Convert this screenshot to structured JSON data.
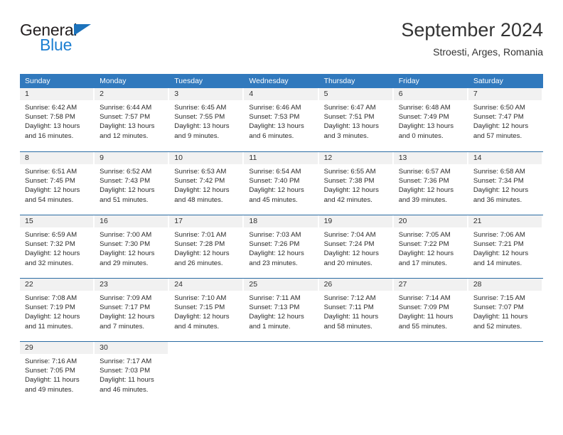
{
  "brand": {
    "name_top": "General",
    "name_bottom": "Blue",
    "triangle_color": "#1c72bb",
    "blue_text_color": "#1c7fd1"
  },
  "header": {
    "title": "September 2024",
    "subtitle": "Stroesti, Arges, Romania"
  },
  "theme": {
    "header_blue": "#3179bd",
    "row_divider": "#2b6ca3",
    "day_band_gray": "#f1f1f1",
    "text_color": "#2b2b2b"
  },
  "calendar": {
    "weekday_headers": [
      "Sunday",
      "Monday",
      "Tuesday",
      "Wednesday",
      "Thursday",
      "Friday",
      "Saturday"
    ],
    "weeks": [
      [
        {
          "day": "1",
          "sunrise": "Sunrise: 6:42 AM",
          "sunset": "Sunset: 7:58 PM",
          "daylight1": "Daylight: 13 hours",
          "daylight2": "and 16 minutes."
        },
        {
          "day": "2",
          "sunrise": "Sunrise: 6:44 AM",
          "sunset": "Sunset: 7:57 PM",
          "daylight1": "Daylight: 13 hours",
          "daylight2": "and 12 minutes."
        },
        {
          "day": "3",
          "sunrise": "Sunrise: 6:45 AM",
          "sunset": "Sunset: 7:55 PM",
          "daylight1": "Daylight: 13 hours",
          "daylight2": "and 9 minutes."
        },
        {
          "day": "4",
          "sunrise": "Sunrise: 6:46 AM",
          "sunset": "Sunset: 7:53 PM",
          "daylight1": "Daylight: 13 hours",
          "daylight2": "and 6 minutes."
        },
        {
          "day": "5",
          "sunrise": "Sunrise: 6:47 AM",
          "sunset": "Sunset: 7:51 PM",
          "daylight1": "Daylight: 13 hours",
          "daylight2": "and 3 minutes."
        },
        {
          "day": "6",
          "sunrise": "Sunrise: 6:48 AM",
          "sunset": "Sunset: 7:49 PM",
          "daylight1": "Daylight: 13 hours",
          "daylight2": "and 0 minutes."
        },
        {
          "day": "7",
          "sunrise": "Sunrise: 6:50 AM",
          "sunset": "Sunset: 7:47 PM",
          "daylight1": "Daylight: 12 hours",
          "daylight2": "and 57 minutes."
        }
      ],
      [
        {
          "day": "8",
          "sunrise": "Sunrise: 6:51 AM",
          "sunset": "Sunset: 7:45 PM",
          "daylight1": "Daylight: 12 hours",
          "daylight2": "and 54 minutes."
        },
        {
          "day": "9",
          "sunrise": "Sunrise: 6:52 AM",
          "sunset": "Sunset: 7:43 PM",
          "daylight1": "Daylight: 12 hours",
          "daylight2": "and 51 minutes."
        },
        {
          "day": "10",
          "sunrise": "Sunrise: 6:53 AM",
          "sunset": "Sunset: 7:42 PM",
          "daylight1": "Daylight: 12 hours",
          "daylight2": "and 48 minutes."
        },
        {
          "day": "11",
          "sunrise": "Sunrise: 6:54 AM",
          "sunset": "Sunset: 7:40 PM",
          "daylight1": "Daylight: 12 hours",
          "daylight2": "and 45 minutes."
        },
        {
          "day": "12",
          "sunrise": "Sunrise: 6:55 AM",
          "sunset": "Sunset: 7:38 PM",
          "daylight1": "Daylight: 12 hours",
          "daylight2": "and 42 minutes."
        },
        {
          "day": "13",
          "sunrise": "Sunrise: 6:57 AM",
          "sunset": "Sunset: 7:36 PM",
          "daylight1": "Daylight: 12 hours",
          "daylight2": "and 39 minutes."
        },
        {
          "day": "14",
          "sunrise": "Sunrise: 6:58 AM",
          "sunset": "Sunset: 7:34 PM",
          "daylight1": "Daylight: 12 hours",
          "daylight2": "and 36 minutes."
        }
      ],
      [
        {
          "day": "15",
          "sunrise": "Sunrise: 6:59 AM",
          "sunset": "Sunset: 7:32 PM",
          "daylight1": "Daylight: 12 hours",
          "daylight2": "and 32 minutes."
        },
        {
          "day": "16",
          "sunrise": "Sunrise: 7:00 AM",
          "sunset": "Sunset: 7:30 PM",
          "daylight1": "Daylight: 12 hours",
          "daylight2": "and 29 minutes."
        },
        {
          "day": "17",
          "sunrise": "Sunrise: 7:01 AM",
          "sunset": "Sunset: 7:28 PM",
          "daylight1": "Daylight: 12 hours",
          "daylight2": "and 26 minutes."
        },
        {
          "day": "18",
          "sunrise": "Sunrise: 7:03 AM",
          "sunset": "Sunset: 7:26 PM",
          "daylight1": "Daylight: 12 hours",
          "daylight2": "and 23 minutes."
        },
        {
          "day": "19",
          "sunrise": "Sunrise: 7:04 AM",
          "sunset": "Sunset: 7:24 PM",
          "daylight1": "Daylight: 12 hours",
          "daylight2": "and 20 minutes."
        },
        {
          "day": "20",
          "sunrise": "Sunrise: 7:05 AM",
          "sunset": "Sunset: 7:22 PM",
          "daylight1": "Daylight: 12 hours",
          "daylight2": "and 17 minutes."
        },
        {
          "day": "21",
          "sunrise": "Sunrise: 7:06 AM",
          "sunset": "Sunset: 7:21 PM",
          "daylight1": "Daylight: 12 hours",
          "daylight2": "and 14 minutes."
        }
      ],
      [
        {
          "day": "22",
          "sunrise": "Sunrise: 7:08 AM",
          "sunset": "Sunset: 7:19 PM",
          "daylight1": "Daylight: 12 hours",
          "daylight2": "and 11 minutes."
        },
        {
          "day": "23",
          "sunrise": "Sunrise: 7:09 AM",
          "sunset": "Sunset: 7:17 PM",
          "daylight1": "Daylight: 12 hours",
          "daylight2": "and 7 minutes."
        },
        {
          "day": "24",
          "sunrise": "Sunrise: 7:10 AM",
          "sunset": "Sunset: 7:15 PM",
          "daylight1": "Daylight: 12 hours",
          "daylight2": "and 4 minutes."
        },
        {
          "day": "25",
          "sunrise": "Sunrise: 7:11 AM",
          "sunset": "Sunset: 7:13 PM",
          "daylight1": "Daylight: 12 hours",
          "daylight2": "and 1 minute."
        },
        {
          "day": "26",
          "sunrise": "Sunrise: 7:12 AM",
          "sunset": "Sunset: 7:11 PM",
          "daylight1": "Daylight: 11 hours",
          "daylight2": "and 58 minutes."
        },
        {
          "day": "27",
          "sunrise": "Sunrise: 7:14 AM",
          "sunset": "Sunset: 7:09 PM",
          "daylight1": "Daylight: 11 hours",
          "daylight2": "and 55 minutes."
        },
        {
          "day": "28",
          "sunrise": "Sunrise: 7:15 AM",
          "sunset": "Sunset: 7:07 PM",
          "daylight1": "Daylight: 11 hours",
          "daylight2": "and 52 minutes."
        }
      ],
      [
        {
          "day": "29",
          "sunrise": "Sunrise: 7:16 AM",
          "sunset": "Sunset: 7:05 PM",
          "daylight1": "Daylight: 11 hours",
          "daylight2": "and 49 minutes."
        },
        {
          "day": "30",
          "sunrise": "Sunrise: 7:17 AM",
          "sunset": "Sunset: 7:03 PM",
          "daylight1": "Daylight: 11 hours",
          "daylight2": "and 46 minutes."
        },
        {
          "day": "",
          "sunrise": "",
          "sunset": "",
          "daylight1": "",
          "daylight2": ""
        },
        {
          "day": "",
          "sunrise": "",
          "sunset": "",
          "daylight1": "",
          "daylight2": ""
        },
        {
          "day": "",
          "sunrise": "",
          "sunset": "",
          "daylight1": "",
          "daylight2": ""
        },
        {
          "day": "",
          "sunrise": "",
          "sunset": "",
          "daylight1": "",
          "daylight2": ""
        },
        {
          "day": "",
          "sunrise": "",
          "sunset": "",
          "daylight1": "",
          "daylight2": ""
        }
      ]
    ]
  }
}
